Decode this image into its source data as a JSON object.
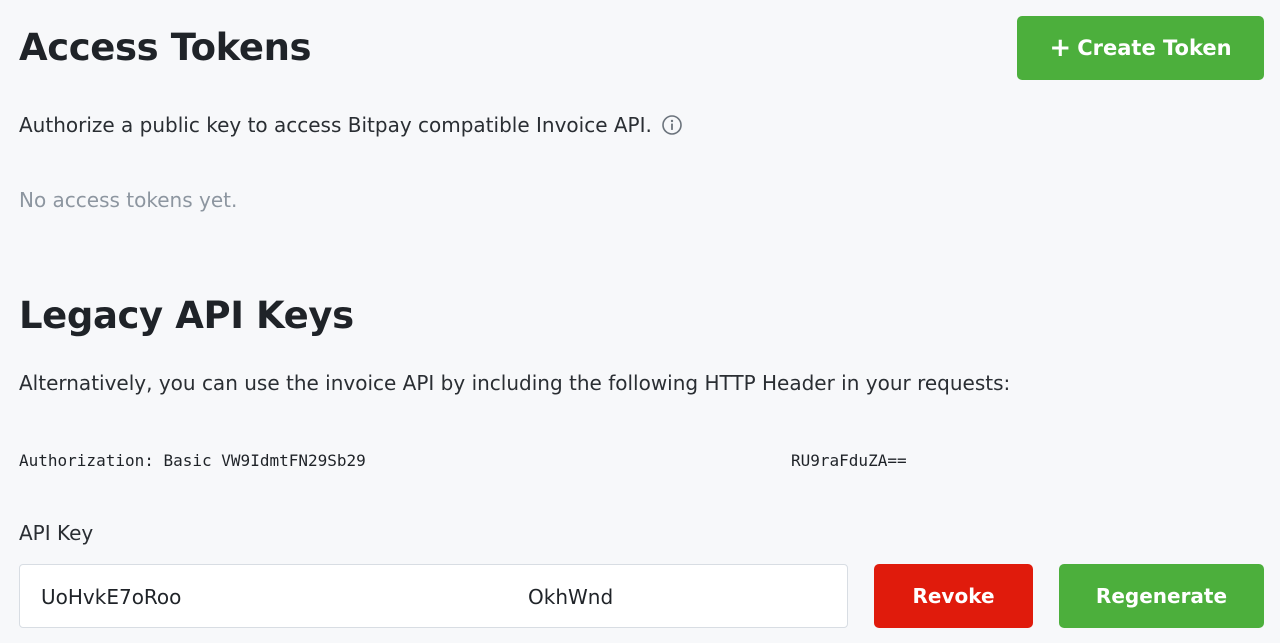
{
  "access_tokens": {
    "title": "Access Tokens",
    "create_button_icon": "plus-icon",
    "create_button_label": "Create Token",
    "description": "Authorize a public key to access Bitpay compatible Invoice API.",
    "info_icon": "info-circle-icon",
    "empty_message": "No access tokens yet."
  },
  "legacy_api_keys": {
    "title": "Legacy API Keys",
    "description": "Alternatively, you can use the invoice API by including the following HTTP Header in your requests:",
    "auth_header_start": "Authorization: Basic VW9IdmtFN29Sb29",
    "auth_header_end": "RU9raFduZA==",
    "api_key_label": "API Key",
    "api_key_value_start": "UoHvkE7oRoo",
    "api_key_value_end": "OkhWnd",
    "revoke_label": "Revoke",
    "regenerate_label": "Regenerate"
  },
  "colors": {
    "primary_green": "#4caf3c",
    "danger_red": "#e01b0c",
    "background": "#f7f8fa",
    "muted_text": "#8d96a0"
  }
}
